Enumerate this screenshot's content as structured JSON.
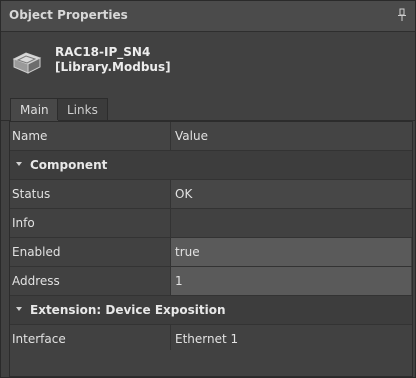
{
  "panel": {
    "title": "Object Properties",
    "pin_icon": "pin-icon"
  },
  "object": {
    "name_line1": "RAC18-IP_SN4",
    "name_line2": "[Library.Modbus]",
    "icon": "device-box-icon"
  },
  "tabs": [
    {
      "label": "Main",
      "active": true
    },
    {
      "label": "Links",
      "active": false
    }
  ],
  "grid": {
    "columns": {
      "name": "Name",
      "value": "Value"
    },
    "sections": [
      {
        "title": "Component",
        "rows": [
          {
            "name": "Status",
            "value": "OK"
          },
          {
            "name": "Info",
            "value": ""
          },
          {
            "name": "Enabled",
            "value": "true"
          },
          {
            "name": "Address",
            "value": "1"
          }
        ]
      },
      {
        "title": "Extension: Device Exposition",
        "rows": [
          {
            "name": "Interface",
            "value": "Ethernet 1"
          }
        ]
      }
    ]
  },
  "colors": {
    "background": "#414141",
    "editable_value": "#5a5a5a"
  }
}
